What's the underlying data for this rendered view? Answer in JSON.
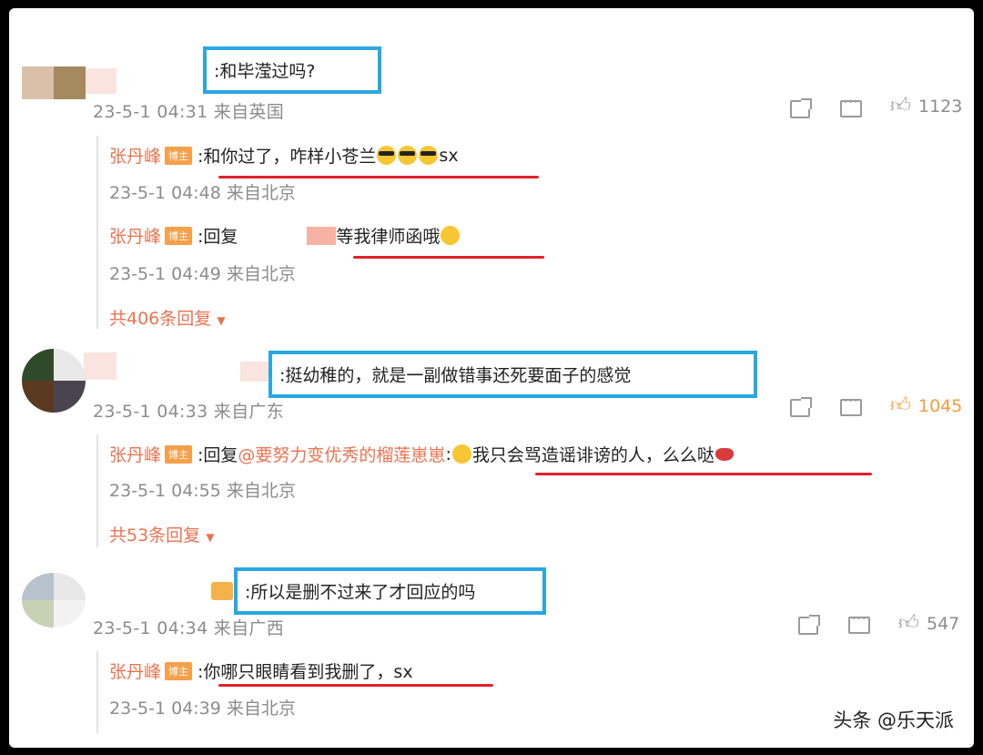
{
  "comments": [
    {
      "text": ":和毕滢过吗?",
      "meta": "23-5-1 04:31 来自英国",
      "likes": "1123",
      "replies": [
        {
          "author": "张丹峰",
          "badge": "博主",
          "text": ":和你过了，咋样小苍兰",
          "suffix": "sx",
          "meta": "23-5-1 04:48 来自北京"
        },
        {
          "author": "张丹峰",
          "badge": "博主",
          "prefix": ":回复",
          "text": "等我律师函哦",
          "meta": "23-5-1 04:49 来自北京"
        }
      ],
      "more": "共406条回复"
    },
    {
      "text": ":挺幼稚的，就是一副做错事还死要面子的感觉",
      "meta": "23-5-1 04:33 来自广东",
      "likes": "1045",
      "replies": [
        {
          "author": "张丹峰",
          "badge": "博主",
          "prefix": ":回复",
          "mention": "@要努力变优秀的榴莲崽崽",
          "text": "我只会骂造谣诽谤的人，么么哒",
          "meta": "23-5-1 04:55 来自北京"
        }
      ],
      "more": "共53条回复"
    },
    {
      "text": ":所以是删不过来了才回应的吗",
      "meta": "23-5-1 04:34 来自广西",
      "likes": "547",
      "replies": [
        {
          "author": "张丹峰",
          "badge": "博主",
          "text": ":你哪只眼睛看到我删了，sx",
          "meta": "23-5-1 04:39 来自北京"
        }
      ]
    }
  ],
  "watermark": "头条 @乐天派",
  "colors": {
    "highlight_box": "#2aa7e3",
    "underline": "#e0222c",
    "author": "#eb7350",
    "badge": "#f5a04a"
  },
  "icons": [
    "share-icon",
    "comment-icon",
    "like-icon",
    "dropdown-arrow-icon",
    "sunglasses-emoji",
    "lips-emoji"
  ]
}
